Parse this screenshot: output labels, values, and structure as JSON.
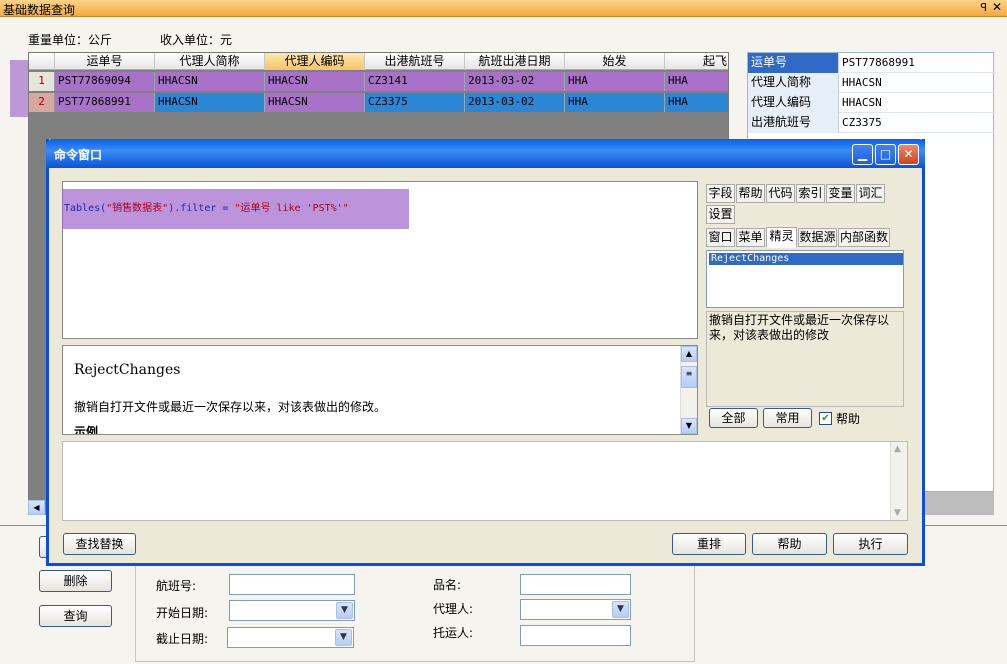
{
  "host": {
    "title": "基础数据查询",
    "pin": "ꟼ",
    "close": "✕",
    "weight_unit": "重量单位：公斤",
    "income_unit": "收入单位：元"
  },
  "grid": {
    "columns": [
      "运单号",
      "代理人简称",
      "代理人编码",
      "出港航班号",
      "航班出港日期",
      "始发",
      "起飞"
    ],
    "rows": [
      {
        "num": "1",
        "cells": [
          "PST77869094",
          "HHACSN",
          "HHACSN",
          "CZ3141",
          "2013-03-02",
          "HHA",
          "HHA"
        ]
      },
      {
        "num": "2",
        "cells": [
          "PST77868991",
          "HHACSN",
          "HHACSN",
          "CZ3375",
          "2013-03-02",
          "HHA",
          "HHA"
        ]
      }
    ]
  },
  "props": [
    {
      "k": "运单号",
      "v": "PST77868991"
    },
    {
      "k": "代理人简称",
      "v": "HHACSN"
    },
    {
      "k": "代理人编码",
      "v": "HHACSN"
    },
    {
      "k": "出港航班号",
      "v": "CZ3375"
    }
  ],
  "form": {
    "buttons": {
      "delete": "删除",
      "query": "查询"
    },
    "labels": {
      "flight": "航班号:",
      "start_date": "开始日期:",
      "end_date": "截止日期:",
      "product": "品名:",
      "agent": "代理人:",
      "shipper": "托运人:"
    }
  },
  "cmd": {
    "title": "命令窗口",
    "code_parts": {
      "a": "Tables(",
      "b": "\"销售数据表\"",
      "c": ").filter = ",
      "d": "\"运单号 like 'PST%'\""
    },
    "help_title": "RejectChanges",
    "help_text": "撤销自打开文件或最近一次保存以来，对该表做出的修改。",
    "help_more": "示例",
    "tabs_row1": [
      "字段",
      "帮助",
      "代码",
      "索引",
      "变量",
      "词汇"
    ],
    "tabs_row2": [
      "设置"
    ],
    "tabs_row3": [
      "窗口",
      "菜单",
      "精灵",
      "数据源",
      "内部函数"
    ],
    "list_selected": "RejectChanges",
    "desc": "撤销自打开文件或最近一次保存以来，对该表做出的修改",
    "btn_all": "全部",
    "btn_common": "常用",
    "chk_help": "帮助",
    "btn_find": "查找替换",
    "btn_reorder": "重排",
    "btn_help": "帮助",
    "btn_exec": "执行"
  },
  "colors": {
    "accent": "#0b4fd6",
    "highlight": "#9b5ac8",
    "selected_row": "#2b86d6"
  }
}
